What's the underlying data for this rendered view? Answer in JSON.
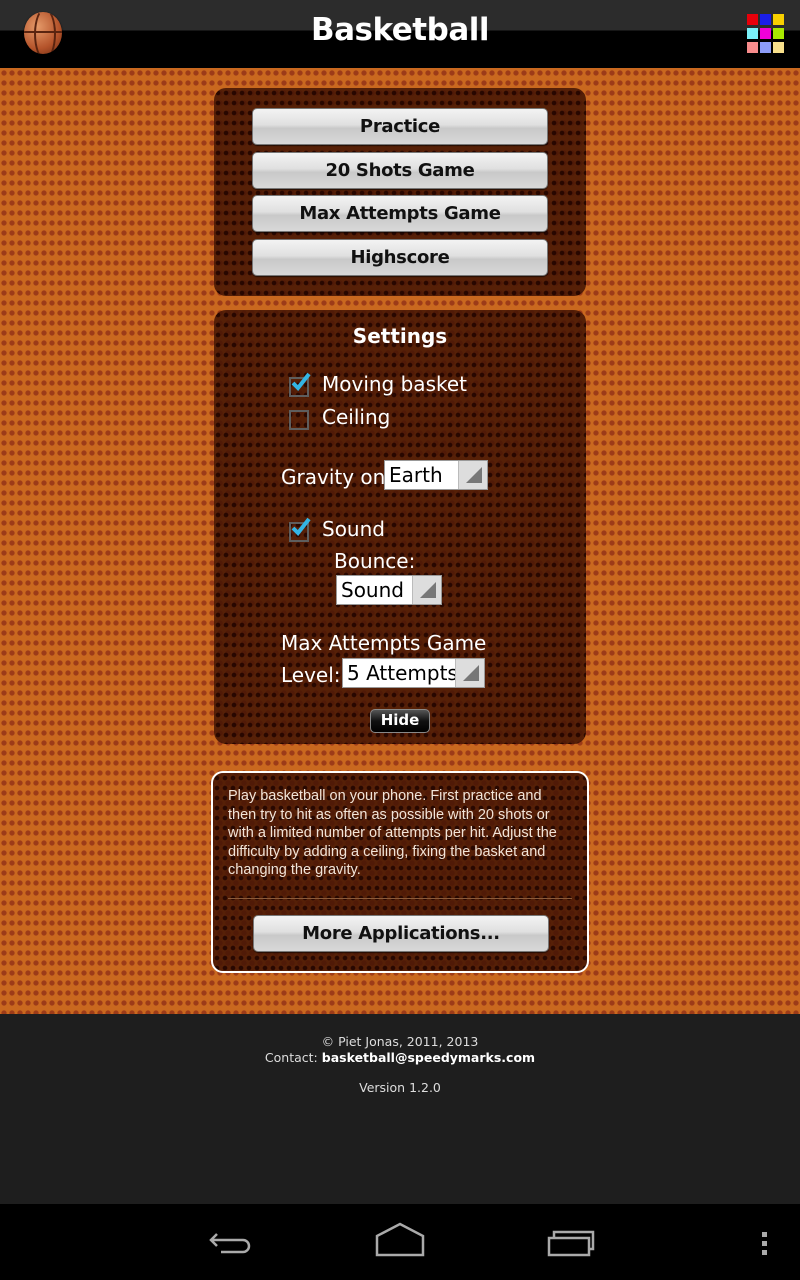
{
  "app": {
    "title": "Basketball",
    "logo_icon": "basketball-icon",
    "more_apps_icon": "color-grid-icon",
    "grid_colors": [
      "#e8000a",
      "#1a1ee8",
      "#f8d000",
      "#7af0f8",
      "#f000d8",
      "#a8e800",
      "#f88c8c",
      "#8c9cf8",
      "#f8e08c"
    ]
  },
  "menu": {
    "buttons": [
      {
        "label": "Practice"
      },
      {
        "label": "20 Shots Game"
      },
      {
        "label": "Max Attempts Game"
      },
      {
        "label": "Highscore"
      }
    ]
  },
  "settings": {
    "title": "Settings",
    "moving_basket": {
      "label": "Moving basket",
      "checked": true
    },
    "ceiling": {
      "label": "Ceiling",
      "checked": false
    },
    "gravity": {
      "label": "Gravity on",
      "value": "Earth"
    },
    "sound": {
      "label": "Sound",
      "checked": true
    },
    "bounce": {
      "label": "Bounce:",
      "value": "Sound"
    },
    "max_attempts": {
      "label_line1": "Max Attempts Game",
      "label_line2": "Level:",
      "value": "5 Attempts"
    },
    "hide_label": "Hide"
  },
  "info": {
    "description": "Play basketball on your phone. First practice and then try to hit as often as possible with 20 shots or with a limited number of attempts per hit. Adjust the difficulty by adding a ceiling, fixing the basket and changing the gravity.",
    "more_apps_label": "More Applications..."
  },
  "footer": {
    "copyright": "© Piet Jonas, 2011, 2013",
    "contact_label": "Contact:",
    "contact_email": "basketball@speedymarks.com",
    "version": "Version 1.2.0"
  },
  "navbar": {
    "back_icon": "back-icon",
    "home_icon": "home-icon",
    "recents_icon": "recent-apps-icon",
    "menu_icon": "overflow-menu-icon"
  }
}
